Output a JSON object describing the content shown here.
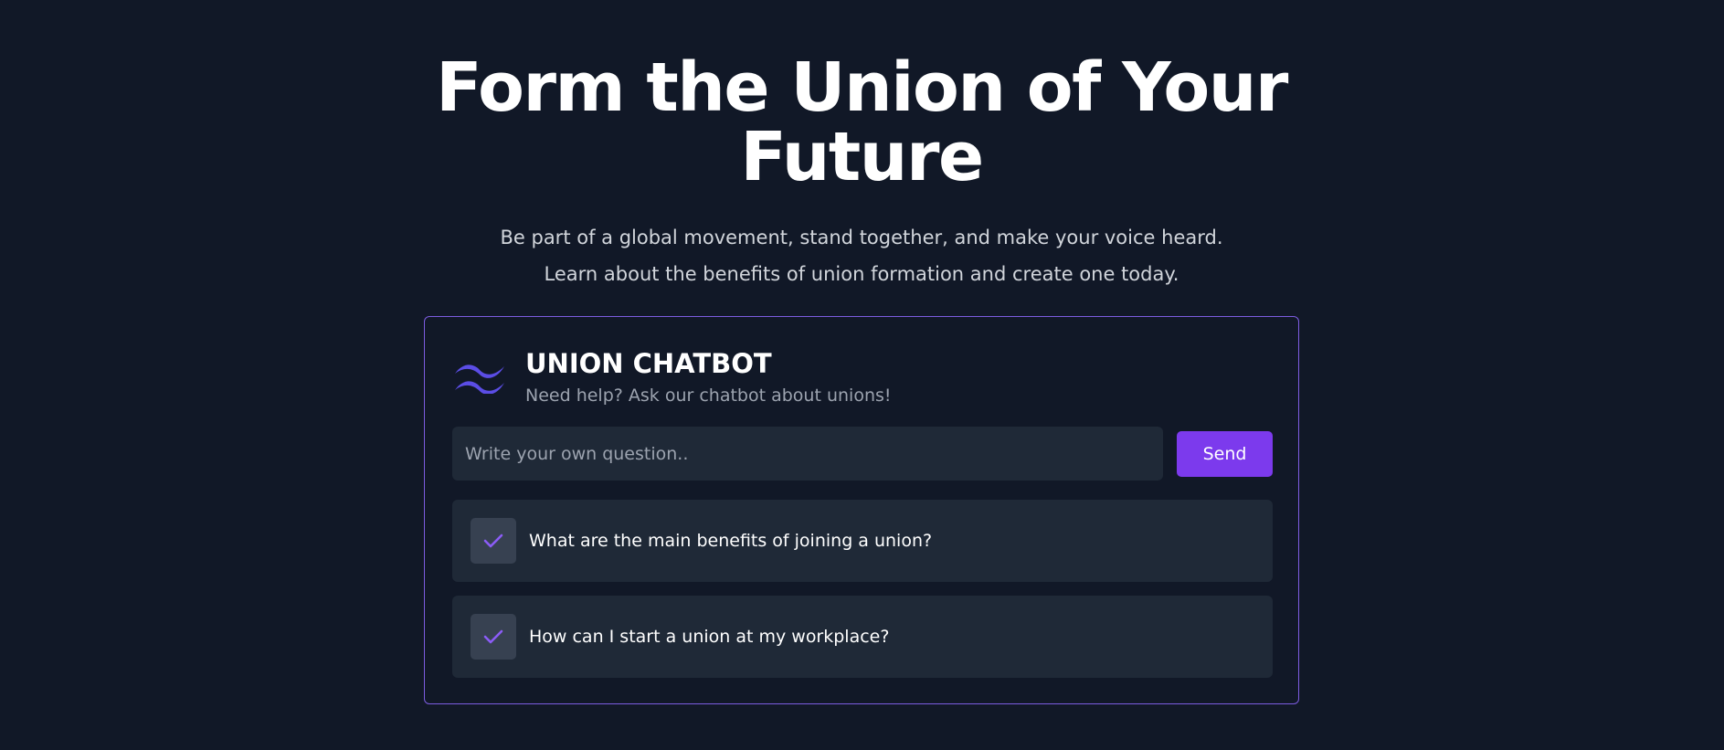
{
  "hero": {
    "title": "Form the Union of Your Future",
    "subtitle": "Be part of a global movement, stand together, and make your voice heard. Learn about the benefits of union formation and create one today."
  },
  "chatbot": {
    "logo_icon": "waves-logo-icon",
    "title": "UNION CHATBOT",
    "subtitle": "Need help? Ask our chatbot about unions!",
    "input": {
      "value": "",
      "placeholder": "Write your own question.."
    },
    "send_label": "Send",
    "suggestions": [
      {
        "icon": "check-icon",
        "text": "What are the main benefits of joining a union?"
      },
      {
        "icon": "check-icon",
        "text": "How can I start a union at my workplace?"
      }
    ]
  },
  "colors": {
    "background": "#111827",
    "panel": "#1f2937",
    "accent": "#7c3aed",
    "border": "#7c5ce0",
    "check": "#8b5cf6"
  }
}
